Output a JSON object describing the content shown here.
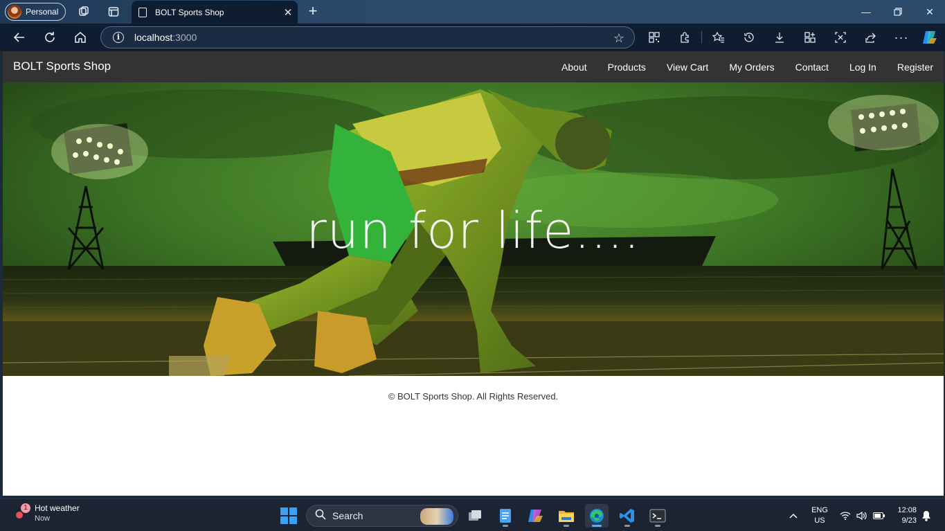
{
  "browser": {
    "profile_label": "Personal",
    "tab_title": "BOLT Sports Shop",
    "address": {
      "host": "localhost",
      "port": ":3000"
    }
  },
  "site": {
    "brand": "BOLT Sports Shop",
    "nav": [
      "About",
      "Products",
      "View Cart",
      "My Orders",
      "Contact",
      "Log In",
      "Register"
    ],
    "hero_tagline": "run for life....",
    "footer": "© BOLT Sports Shop. All Rights Reserved."
  },
  "taskbar": {
    "weather_title": "Hot weather",
    "weather_time": "Now",
    "weather_badge": "1",
    "search_label": "Search",
    "lang_line1": "ENG",
    "lang_line2": "US",
    "time": "12:08",
    "date": "9/23"
  },
  "colors": {
    "navbar": "#333333",
    "browser_dark": "#0f1d33",
    "taskbar": "#1c2433",
    "hero_green": "#3f7e26"
  }
}
